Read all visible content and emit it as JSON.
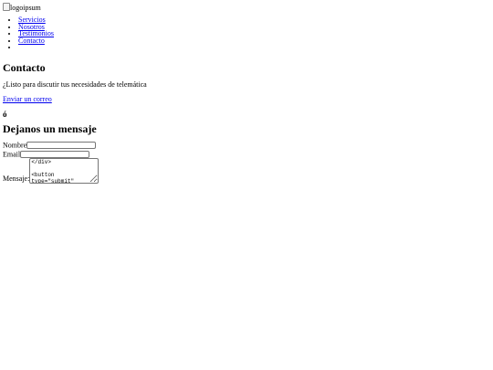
{
  "header": {
    "logo_alt": "logoipsum"
  },
  "nav": {
    "items": [
      {
        "label": "Servicios"
      },
      {
        "label": "Nosotros"
      },
      {
        "label": "Testimonios"
      },
      {
        "label": "Contacto"
      },
      {
        "label": ""
      }
    ]
  },
  "contact": {
    "title": "Contacto",
    "lead": "¿Listo para discutir tus necesidades de telemática",
    "email_link": "Enviar un correo",
    "or_text": "ó"
  },
  "form": {
    "title": "Dejanos un mensaje",
    "name_label": "Nombre",
    "name_value": "",
    "email_label": "Email",
    "email_value": "",
    "message_label": "Mensaje:",
    "message_value": "</div>\n\n<button type=\"submit\" class=\"submit-"
  }
}
